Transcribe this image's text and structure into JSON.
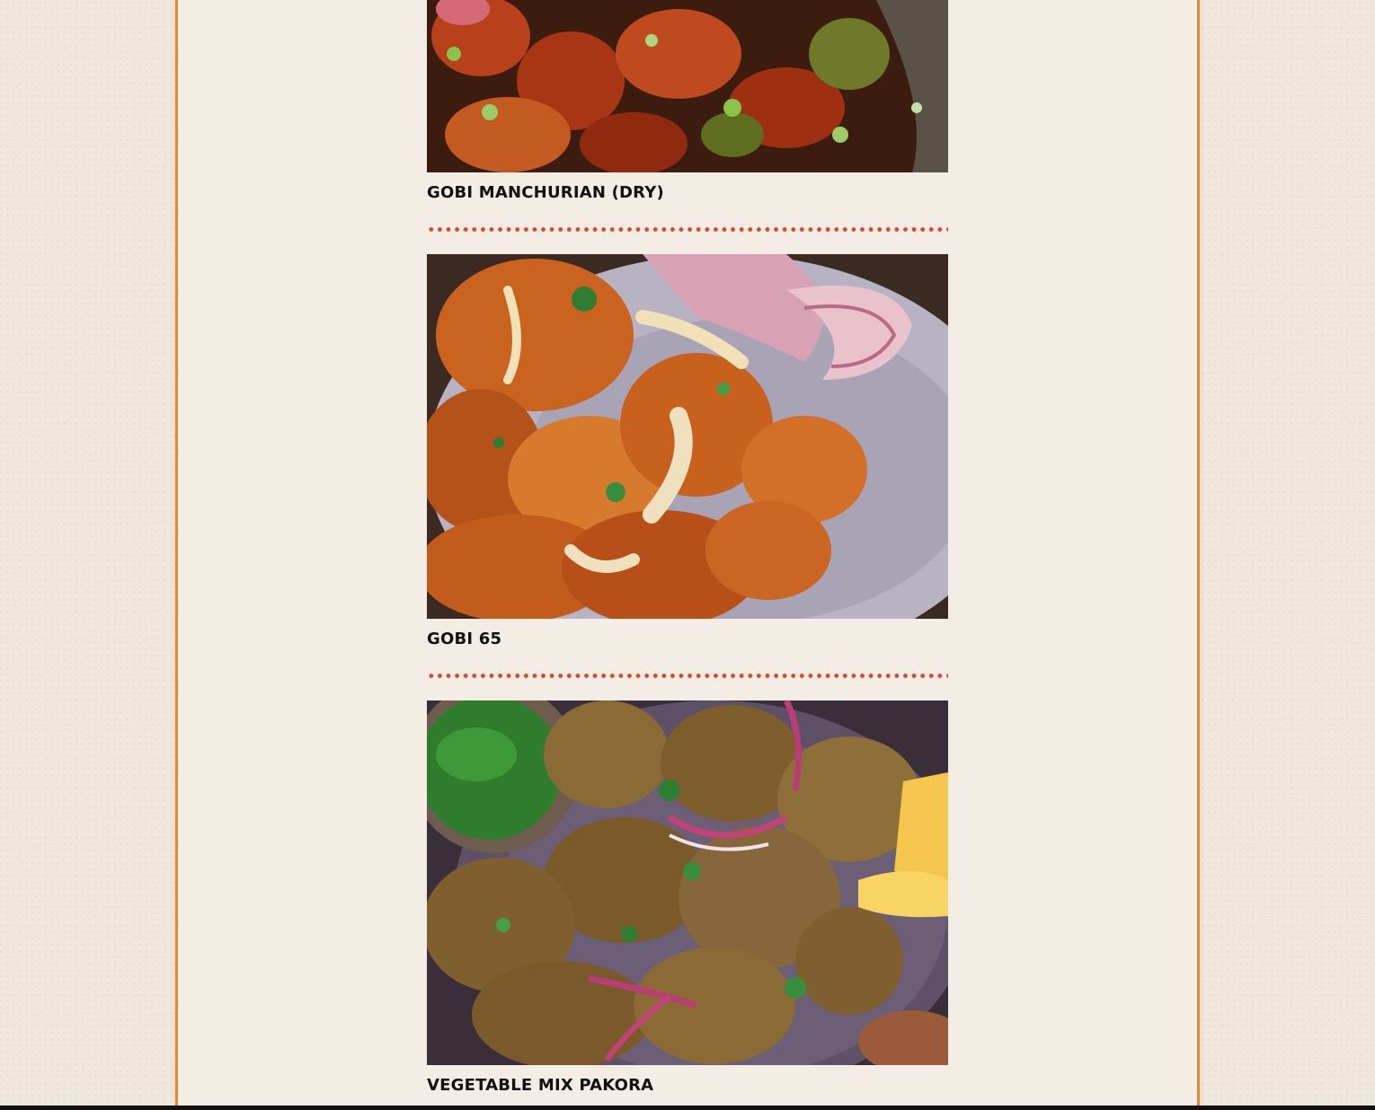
{
  "menu": {
    "items": [
      {
        "name": "GOBI MANCHURIAN (DRY)",
        "photo_icon": "gobi-manchurian-photo"
      },
      {
        "name": "GOBI 65",
        "photo_icon": "gobi-65-photo"
      },
      {
        "name": "VEGETABLE MIX PAKORA",
        "photo_icon": "vegetable-pakora-photo"
      }
    ]
  },
  "colors": {
    "page_background": "#efe6dd",
    "panel_background": "#f4ede6",
    "panel_border": "#e8892e",
    "divider_dots": "#e0452e",
    "text": "#111111"
  }
}
